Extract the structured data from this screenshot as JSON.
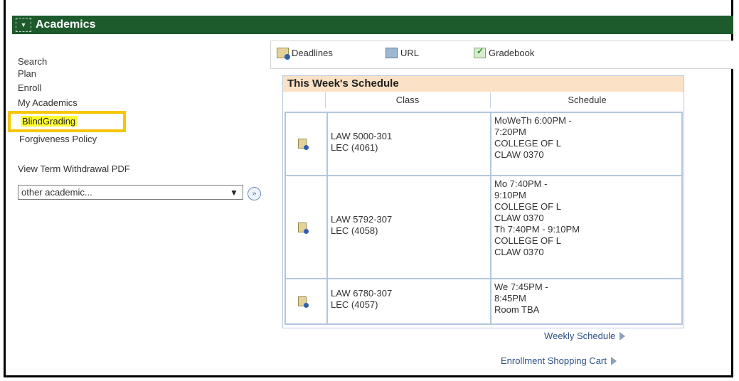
{
  "header": {
    "title": "Academics"
  },
  "left_nav": {
    "search": "Search",
    "plan": "Plan",
    "enroll": "Enroll",
    "my_academics": "My Academics",
    "blind_grading": "BlindGrading",
    "forgiveness_policy": "Forgiveness Policy",
    "withdrawal_pdf": "View Term Withdrawal PDF",
    "select_value": "other academic..."
  },
  "toolbar": {
    "deadlines": "Deadlines",
    "url": "URL",
    "gradebook": "Gradebook"
  },
  "schedule": {
    "title": "This Week's Schedule",
    "col_class": "Class",
    "col_schedule": "Schedule",
    "rows": [
      {
        "class_line1": "LAW 5000-301",
        "class_line2": "LEC (4061)",
        "sched": [
          "MoWeTh 6:00PM -",
          "7:20PM",
          "COLLEGE OF L",
          "CLAW 0370"
        ]
      },
      {
        "class_line1": "LAW 5792-307",
        "class_line2": "LEC (4058)",
        "sched": [
          "Mo 7:40PM -",
          "9:10PM",
          "COLLEGE OF L",
          "CLAW 0370",
          "Th 7:40PM - 9:10PM",
          "COLLEGE OF L",
          "CLAW 0370"
        ]
      },
      {
        "class_line1": "LAW 6780-307",
        "class_line2": "LEC (4057)",
        "sched": [
          "We 7:45PM -",
          "8:45PM",
          "Room  TBA"
        ]
      }
    ]
  },
  "footer": {
    "weekly": "Weekly Schedule",
    "cart": "Enrollment Shopping Cart"
  },
  "colors": {
    "header_bg": "#1d5a2c",
    "highlight": "#f7c600",
    "schedule_title_bg": "#fbe1c6"
  }
}
